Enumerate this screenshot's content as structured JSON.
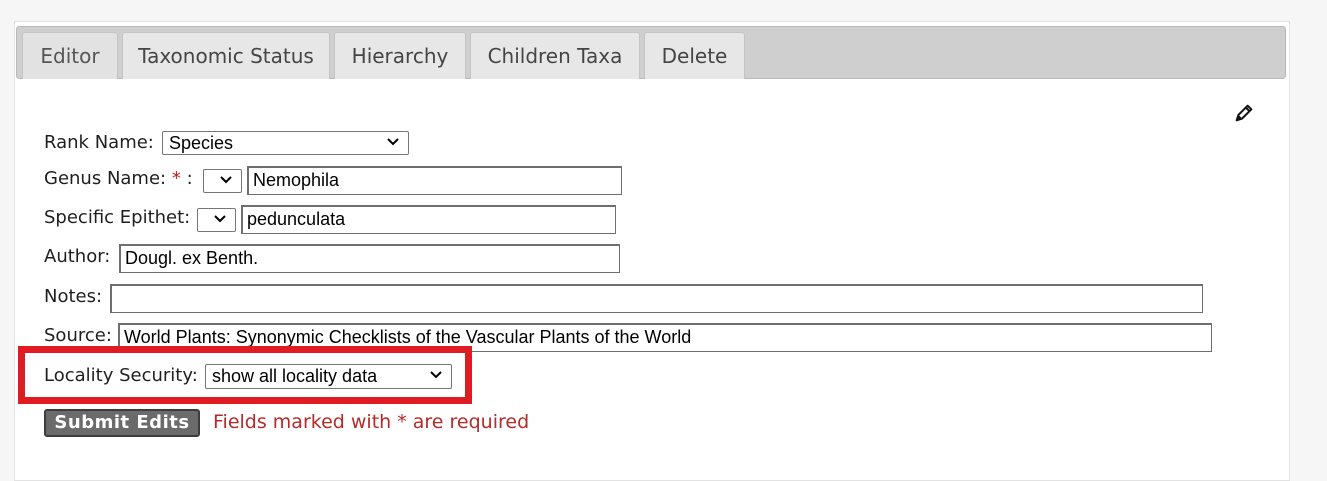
{
  "tabs": [
    "Editor",
    "Taxonomic Status",
    "Hierarchy",
    "Children Taxa",
    "Delete"
  ],
  "form": {
    "rank_label": "Rank Name:",
    "rank_value": "Species",
    "genus_label": "Genus Name:",
    "required_mark": "*",
    "genus_colon": ":",
    "genus_value": "Nemophila",
    "epithet_label": "Specific Epithet:",
    "epithet_value": "pedunculata",
    "author_label": "Author:",
    "author_value": "Dougl. ex Benth.",
    "notes_label": "Notes:",
    "notes_value": "",
    "source_label": "Source:",
    "source_value": "World Plants: Synonymic Checklists of the Vascular Plants of the World",
    "locality_label": "Locality Security:",
    "locality_value": "show all locality data"
  },
  "submit_label": "Submit Edits",
  "required_note": "Fields marked with * are required",
  "icons": {
    "edit": "pencil-icon",
    "dropdown": "chevron-down-icon"
  },
  "colors": {
    "highlight": "#e01b22",
    "required": "#b52a2a",
    "submit_bg": "#6b6b6b"
  }
}
